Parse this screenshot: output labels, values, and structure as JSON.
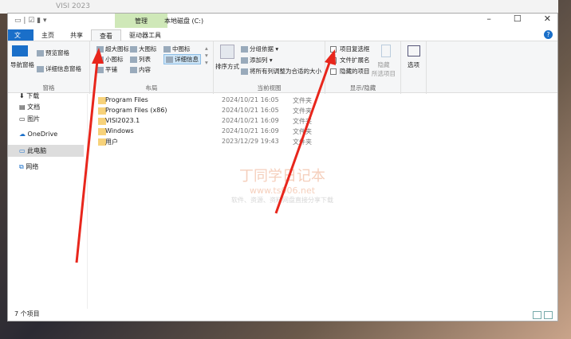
{
  "back_window": {
    "title": "VISI 2023"
  },
  "window": {
    "title": "本地磁盘 (C:)",
    "context_tab": "管理"
  },
  "tabs": [
    "文件",
    "主页",
    "共享",
    "查看",
    "驱动器工具"
  ],
  "ribbon": {
    "pane": {
      "label": "窗格",
      "nav": "导航窗格",
      "preview": "预览窗格",
      "details": "详细信息窗格"
    },
    "layout": {
      "label": "布局",
      "items": [
        "超大图标",
        "大图标",
        "中图标",
        "小图标",
        "列表",
        "详细信息",
        "平铺",
        "内容"
      ]
    },
    "current_view": {
      "label": "当前视图",
      "sort": "排序方式",
      "group": "分组依据",
      "add_col": "添加列",
      "fit": "将所有列调整为合适的大小"
    },
    "show_hide": {
      "label": "显示/隐藏",
      "checkboxes": "项目复选框",
      "extensions": "文件扩展名",
      "hidden": "隐藏的项目",
      "hide_selected": "隐藏\n所选项目"
    },
    "options": "选项"
  },
  "sidebar": [
    "下载",
    "文档",
    "图片",
    "OneDrive",
    "此电脑",
    "网络"
  ],
  "files": [
    {
      "name": "Program Files",
      "date": "2024/10/21 16:05",
      "type": "文件夹"
    },
    {
      "name": "Program Files (x86)",
      "date": "2024/10/21 16:05",
      "type": "文件夹"
    },
    {
      "name": "VISI2023.1",
      "date": "2024/10/21 16:09",
      "type": "文件夹"
    },
    {
      "name": "Windows",
      "date": "2024/10/21 16:09",
      "type": "文件夹"
    },
    {
      "name": "用户",
      "date": "2023/12/29 19:43",
      "type": "文件夹"
    }
  ],
  "status": "7 个项目",
  "watermark": {
    "name": "丁同学日记本",
    "url": "www.ts006.net",
    "slogan": "软件、资源、资料网盘直接分享下载"
  },
  "colors": {
    "accent": "#1a6fc9",
    "context": "#cfe8b8",
    "arrow": "#e8261c"
  }
}
